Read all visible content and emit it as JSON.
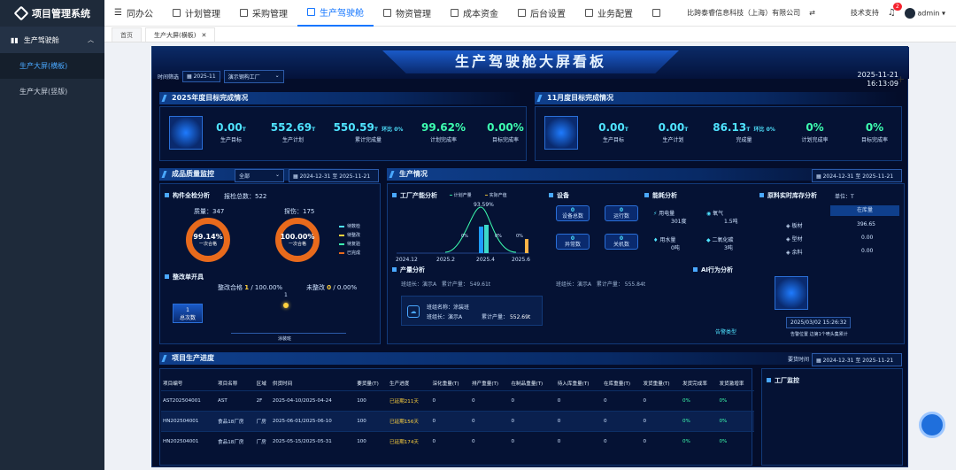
{
  "app": {
    "title": "项目管理系统"
  },
  "sidebar": {
    "group": "生产驾驶舱",
    "items": [
      {
        "label": "生产大屏(横板)",
        "active": true
      },
      {
        "label": "生产大屏(竖版)",
        "active": false
      }
    ]
  },
  "topnav": {
    "items": [
      {
        "label": "同办公",
        "icon": "list-icon"
      },
      {
        "label": "计划管理",
        "icon": "grid-icon"
      },
      {
        "label": "采购管理",
        "icon": "grid-icon"
      },
      {
        "label": "生产驾驶舱",
        "icon": "grid-icon",
        "active": true
      },
      {
        "label": "物资管理",
        "icon": "grid-icon"
      },
      {
        "label": "成本资金",
        "icon": "grid-icon"
      },
      {
        "label": "后台设置",
        "icon": "grid-icon"
      },
      {
        "label": "业务配置",
        "icon": "grid-icon"
      }
    ],
    "company": "比跨泰睿信息科技（上海）有限公司",
    "support": "技术支持",
    "notification_count": "2",
    "user": "admin"
  },
  "tabs": [
    {
      "label": "首页"
    },
    {
      "label": "生产大屏(横板)",
      "active": true
    }
  ],
  "dashboard": {
    "title": "生产驾驶舱大屏看板",
    "filter_label": "时间筛选",
    "filter_month": "2025-11",
    "filter_factory": "演示钢构工厂",
    "clock_date": "2025-11-21",
    "clock_time": "16:13:09",
    "year_panel": {
      "title": "2025年度目标完成情况",
      "kpis": [
        {
          "value": "0.00",
          "unit": "T",
          "label": "生产目标"
        },
        {
          "value": "552.69",
          "unit": "T",
          "label": "生产计划"
        },
        {
          "value": "550.59",
          "unit": "T",
          "label": "累计完成量",
          "sub": "环比 0%"
        },
        {
          "value": "99.62%",
          "unit": "",
          "label": "计划完成率"
        },
        {
          "value": "0.00%",
          "unit": "",
          "label": "目标完成率"
        }
      ]
    },
    "month_panel": {
      "title": "11月度目标完成情况",
      "kpis": [
        {
          "value": "0.00",
          "unit": "T",
          "label": "生产目标"
        },
        {
          "value": "0.00",
          "unit": "T",
          "label": "生产计划"
        },
        {
          "value": "86.13",
          "unit": "T",
          "label": "完成量",
          "sub": "环比 0%"
        },
        {
          "value": "0%",
          "unit": "",
          "label": "计划完成率"
        },
        {
          "value": "0%",
          "unit": "",
          "label": "目标完成率"
        }
      ]
    },
    "quality": {
      "title": "成品质量监控",
      "select": "全部",
      "date_range": "2024-12-31  至  2025-11-21",
      "section": "构件全检分析",
      "report_total": "报检总数：522",
      "quality_label": "质量：347",
      "welding_label": "探伤：175",
      "ring1_pct": "99.14%",
      "ring1_sub": "一次合格",
      "ring2_pct": "100.00%",
      "ring2_sub": "一次合格",
      "legend": [
        {
          "label": "待数检",
          "color": "#4fe3ff"
        },
        {
          "label": "待整改",
          "color": "#ffd23f"
        },
        {
          "label": "待复验",
          "color": "#3dffb0"
        },
        {
          "label": "已完成",
          "color": "#e86a1c"
        }
      ],
      "rect_section": "整改单开具",
      "rect_count": "1",
      "rect_count_label": "总次数",
      "rect_pass": "整改合格",
      "rect_pass_value": "1",
      "rect_pass_pct": "100.00%",
      "rect_fail": "未整改",
      "rect_fail_value": "0",
      "rect_fail_pct": "0.00%",
      "rect_scatter_value": "1",
      "rect_scatter_cat": "涂装班"
    },
    "production": {
      "title": "生产情况",
      "date_range": "2024-12-31  至  2025-11-21",
      "capacity_section": "工厂产能分析",
      "legend_plan": "计划产量",
      "legend_actual": "实际产值",
      "chart_labels": [
        "93.59%",
        "0%",
        "0%",
        "0%"
      ],
      "chart_x": [
        "2024.12",
        "2025.2",
        "2025.4",
        "2025.6"
      ],
      "equipment_section": "设备",
      "devices": [
        {
          "value": "0",
          "label": "设备总数"
        },
        {
          "value": "0",
          "label": "运行数"
        },
        {
          "value": "0",
          "label": "异常数"
        },
        {
          "value": "0",
          "label": "关机数"
        }
      ],
      "energy_section": "能耗分析",
      "energy": [
        {
          "label": "用电量",
          "value": "301度"
        },
        {
          "label": "氧气",
          "value": "1.5吨"
        },
        {
          "label": "用水量",
          "value": "0吨"
        },
        {
          "label": "二氧化碳",
          "value": "3吨"
        }
      ],
      "inventory_section": "原料实时库存分析",
      "inventory_unit": "单位：T",
      "inventory_header": "在库量",
      "inventory": [
        {
          "name": "板材",
          "value": "396.65"
        },
        {
          "name": "型材",
          "value": "0.00"
        },
        {
          "name": "余料",
          "value": "0.00"
        }
      ],
      "output_section": "产量分析",
      "output_rows": [
        {
          "team": "",
          "leader": "班组长：演示A",
          "total": "累计产量：",
          "amount": "549.61t"
        },
        {
          "team": "班组名称：涂装班",
          "leader": "班组长：演示A",
          "total": "累计产量：",
          "amount": "552.69t"
        }
      ],
      "output_rows_right": [
        {
          "leader": "班组长：演示A",
          "total": "累计产量：",
          "amount": "555.84t"
        }
      ],
      "ai_section": "AI行为分析",
      "ai_time": "2025/03/02 15:26:32",
      "ai_alert_type": "告警类型",
      "ai_alert_location": "告警位置 边第1个喷头集累计"
    },
    "progress": {
      "title": "项目生产进度",
      "filter_label": "要货时间",
      "date_range": "2024-12-31  至  2025-11-21",
      "columns": [
        "项目编号",
        "项目名称",
        "区域",
        "供货时间",
        "要货量(T)",
        "生产进度",
        "深化重量(T)",
        "排产重量(T)",
        "在制品重量(T)",
        "待入库重量(T)",
        "在库重量(T)",
        "发货重量(T)",
        "发货完成率",
        "发货激增率"
      ],
      "rows": [
        [
          "AST202504001",
          "AST",
          "2F",
          "2025-04-10/2025-04-24",
          "100",
          "已延期211天",
          "0",
          "0",
          "0",
          "0",
          "0",
          "0",
          "0%",
          "0%"
        ],
        [
          "HN202504001",
          "食品18厂房",
          "厂房",
          "2025-06-01/2025-06-10",
          "100",
          "已延期156天",
          "0",
          "0",
          "0",
          "0",
          "0",
          "0",
          "0%",
          "0%"
        ],
        [
          "HN202504001",
          "食品18厂房",
          "厂房",
          "2025-05-15/2025-05-31",
          "100",
          "已延期174天",
          "0",
          "0",
          "0",
          "0",
          "0",
          "0",
          "0%",
          "0%"
        ]
      ],
      "factory_section": "工厂监控"
    }
  },
  "colors": {
    "accent": "#1677ff",
    "sidebar_bg": "#1e2a3a",
    "screen_bg": "#040d2a",
    "cyan": "#4fe3ff",
    "green": "#3dffb0",
    "orange": "#e86a1c"
  }
}
